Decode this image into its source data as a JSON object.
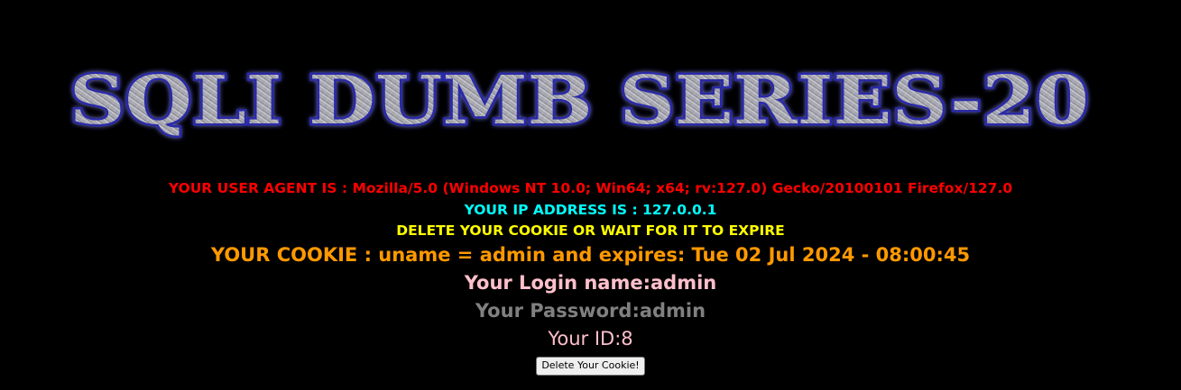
{
  "banner": {
    "title": "SQLI DUMB SERIES-20"
  },
  "info": {
    "user_agent": "YOUR USER AGENT IS : Mozilla/5.0 (Windows NT 10.0; Win64; x64; rv:127.0) Gecko/20100101 Firefox/127.0",
    "ip_address": "YOUR IP ADDRESS IS : 127.0.0.1",
    "delete_note": "DELETE YOUR COOKIE OR WAIT FOR IT TO EXPIRE",
    "cookie": "YOUR COOKIE : uname = admin and expires: Tue 02 Jul 2024 - 08:00:45",
    "login_name": "Your Login name:admin",
    "password": "Your Password:admin",
    "your_id": "Your ID:8"
  },
  "form": {
    "delete_button_label": "Delete Your Cookie!"
  },
  "colors": {
    "background": "#000000",
    "user_agent": "#ff0000",
    "ip_address": "#00ffff",
    "delete_note": "#ffff00",
    "cookie": "#ff9900",
    "login_name": "#ffc0cb",
    "password": "#808080",
    "your_id": "#ffc0cb",
    "banner_fill": "#a9a9b2",
    "banner_outline": "#2b2ba8"
  }
}
